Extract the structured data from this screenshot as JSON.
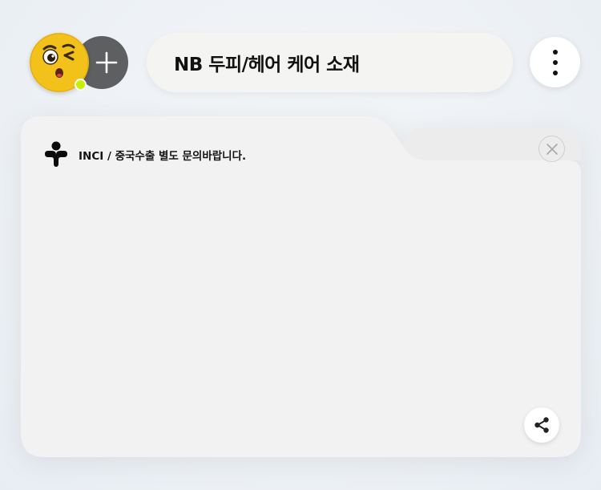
{
  "header": {
    "title": "NB 두피/헤어 케어 소재"
  },
  "card": {
    "header_text": "INCI / 중국수출 별도 문의바랍니다."
  },
  "colors": {
    "avatar_yellow": "#f2c21b",
    "online_dot": "#c8f000",
    "add_button_bg": "#5d5f61",
    "card_bg": "#f2f2f2"
  },
  "icons": {
    "avatar": "winking-face-emoji",
    "add": "plus-icon",
    "menu": "vertical-ellipsis-icon",
    "logo": "brand-logo-icon",
    "close": "close-icon",
    "share": "share-icon"
  }
}
